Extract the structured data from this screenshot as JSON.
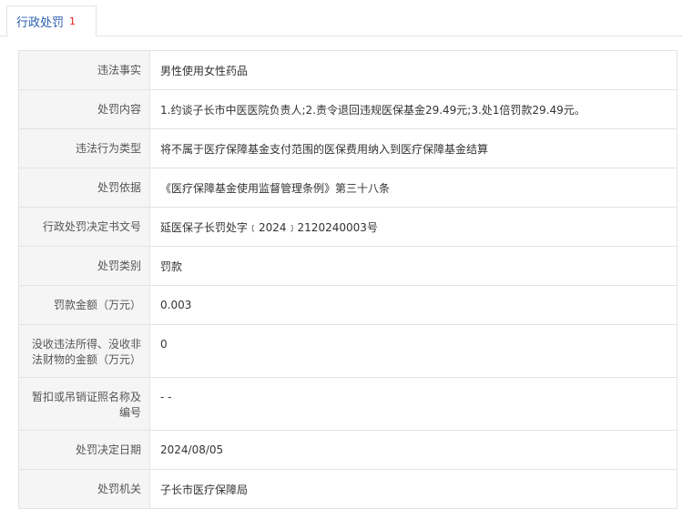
{
  "tab": {
    "label": "行政处罚",
    "badge": "1"
  },
  "rows": [
    {
      "label": "违法事实",
      "value": "男性使用女性药品"
    },
    {
      "label": "处罚内容",
      "value": "1.约谈子长市中医医院负责人;2.责令退回违规医保基金29.49元;3.处1倍罚款29.49元。"
    },
    {
      "label": "违法行为类型",
      "value": "将不属于医疗保障基金支付范围的医保费用纳入到医疗保障基金结算"
    },
    {
      "label": "处罚依据",
      "value": "《医疗保障基金使用监督管理条例》第三十八条"
    },
    {
      "label": "行政处罚决定书文号",
      "value": "延医保子长罚处字﹝2024﹞2120240003号"
    },
    {
      "label": "处罚类别",
      "value": "罚款"
    },
    {
      "label": "罚款金额（万元）",
      "value": "0.003"
    },
    {
      "label": "没收违法所得、没收非法财物的金额（万元）",
      "value": "0"
    },
    {
      "label": "暂扣或吊销证照名称及编号",
      "value": "- -"
    },
    {
      "label": "处罚决定日期",
      "value": "2024/08/05"
    },
    {
      "label": "处罚机关",
      "value": "子长市医疗保障局"
    }
  ]
}
